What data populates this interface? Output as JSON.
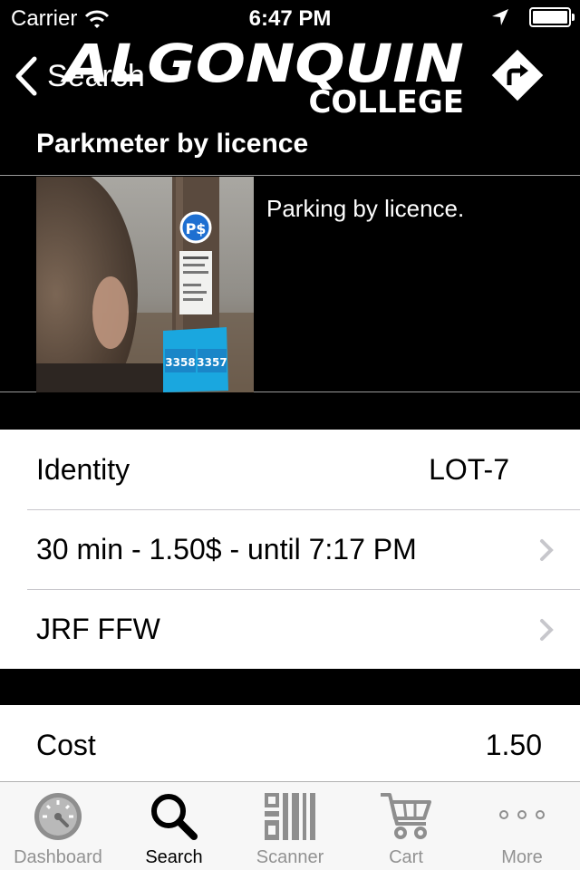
{
  "status_bar": {
    "carrier": "Carrier",
    "time": "6:47 PM",
    "battery_level": 1.0
  },
  "nav": {
    "back_label": "Search",
    "logo_line1": "ALGONQUIN",
    "logo_line2": "COLLEGE",
    "directions_icon": "directions-arrow-icon"
  },
  "item": {
    "title": "Parkmeter by licence",
    "description": "Parking by licence.",
    "photo_labels": [
      "3358",
      "3357"
    ],
    "photo_sign": "P$"
  },
  "details": [
    {
      "label": "Identity",
      "value": "LOT-7",
      "chevron": false
    },
    {
      "label": "30 min - 1.50$ - until 7:17 PM",
      "value": "",
      "chevron": true
    },
    {
      "label": "JRF FFW",
      "value": "",
      "chevron": true
    }
  ],
  "cost": {
    "label": "Cost",
    "value": "1.50"
  },
  "tabs": [
    {
      "label": "Dashboard",
      "icon": "dashboard-gauge-icon",
      "active": false
    },
    {
      "label": "Search",
      "icon": "search-icon",
      "active": true
    },
    {
      "label": "Scanner",
      "icon": "qr-code-icon",
      "active": false
    },
    {
      "label": "Cart",
      "icon": "cart-icon",
      "active": false
    },
    {
      "label": "More",
      "icon": "more-dots-icon",
      "active": false
    }
  ],
  "colors": {
    "background": "#000000",
    "cell": "#ffffff",
    "separator": "#c8c7cc",
    "tab_inactive": "#929292",
    "chevron": "#c7c7cc"
  }
}
